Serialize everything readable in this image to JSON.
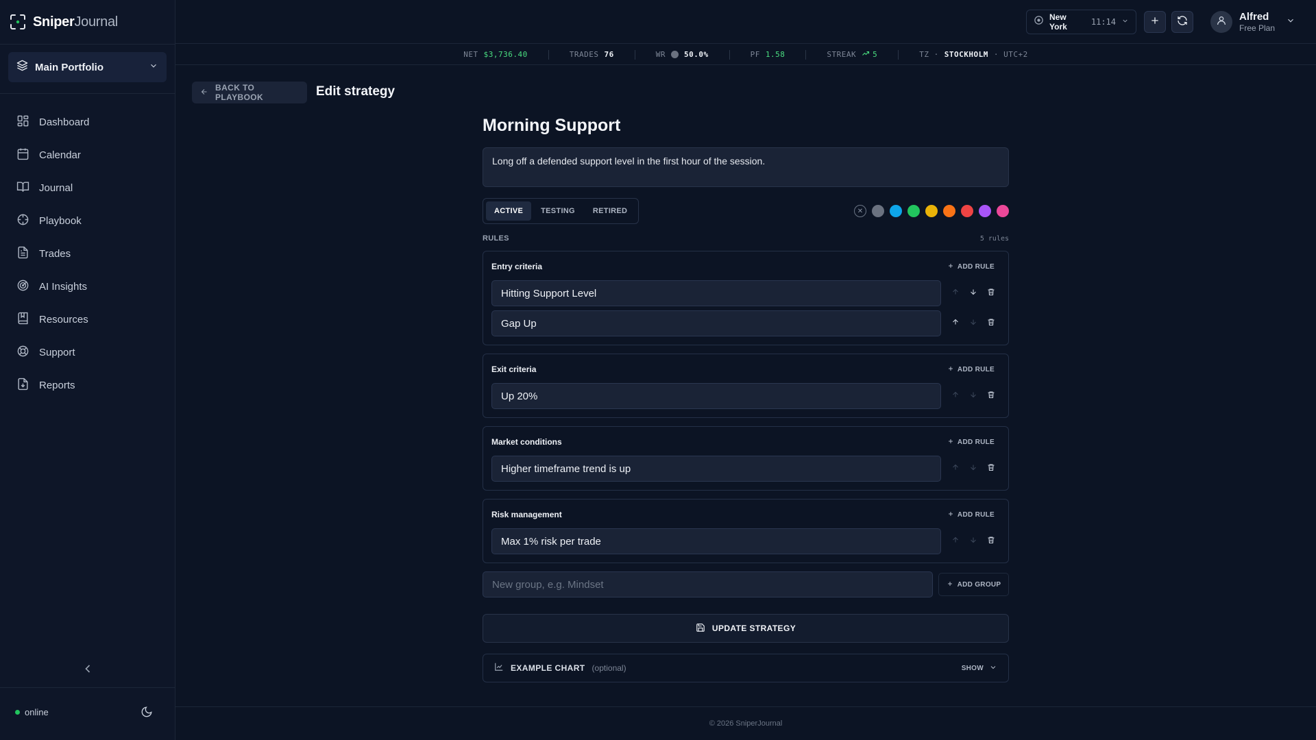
{
  "app": {
    "brand_bold": "Sniper",
    "brand_light": "Journal"
  },
  "sidebar": {
    "portfolio": "Main Portfolio",
    "items": [
      {
        "label": "Dashboard",
        "icon": "grid-icon"
      },
      {
        "label": "Calendar",
        "icon": "calendar-icon"
      },
      {
        "label": "Journal",
        "icon": "book-icon"
      },
      {
        "label": "Playbook",
        "icon": "crosshair-icon"
      },
      {
        "label": "Trades",
        "icon": "file-text-icon"
      },
      {
        "label": "AI Insights",
        "icon": "radar-icon"
      },
      {
        "label": "Resources",
        "icon": "bookmark-book-icon"
      },
      {
        "label": "Support",
        "icon": "lifebuoy-icon"
      },
      {
        "label": "Reports",
        "icon": "file-download-icon"
      }
    ],
    "status": "online"
  },
  "header": {
    "timezone_city": "New York",
    "timezone_time": "11:14",
    "user_name": "Alfred",
    "user_plan": "Free Plan"
  },
  "stats": {
    "net_label": "NET",
    "net_value": "$3,736.40",
    "trades_label": "TRADES",
    "trades_value": "76",
    "wr_label": "WR",
    "wr_value": "50.0%",
    "pf_label": "PF",
    "pf_value": "1.58",
    "streak_label": "STREAK",
    "streak_value": "5",
    "tz_label": "TZ ·",
    "tz_city": "STOCKHOLM",
    "tz_offset": "· UTC+2"
  },
  "page": {
    "back_label": "BACK TO PLAYBOOK",
    "title": "Edit strategy"
  },
  "strategy": {
    "name": "Morning Support",
    "description": "Long off a defended support level in the first hour of the session.",
    "status_options": [
      "ACTIVE",
      "TESTING",
      "RETIRED"
    ],
    "status_selected": "ACTIVE",
    "colors": [
      "#6b7280",
      "#0ea5e9",
      "#22c55e",
      "#eab308",
      "#f97316",
      "#ef4444",
      "#a855f7",
      "#ec4899"
    ],
    "rules_label": "RULES",
    "rules_count": "5 rules",
    "add_rule_label": "ADD RULE",
    "groups": [
      {
        "title": "Entry criteria",
        "rules": [
          "Hitting Support Level",
          "Gap Up"
        ]
      },
      {
        "title": "Exit criteria",
        "rules": [
          "Up 20%"
        ]
      },
      {
        "title": "Market conditions",
        "rules": [
          "Higher timeframe trend is up"
        ]
      },
      {
        "title": "Risk management",
        "rules": [
          "Max 1% risk per trade"
        ]
      }
    ],
    "new_group_placeholder": "New group, e.g. Mindset",
    "add_group_label": "ADD GROUP",
    "update_label": "UPDATE STRATEGY",
    "example_chart_label": "EXAMPLE CHART",
    "example_chart_optional": "(optional)",
    "show_label": "SHOW"
  },
  "footer": {
    "text": "© 2026 SniperJournal"
  }
}
